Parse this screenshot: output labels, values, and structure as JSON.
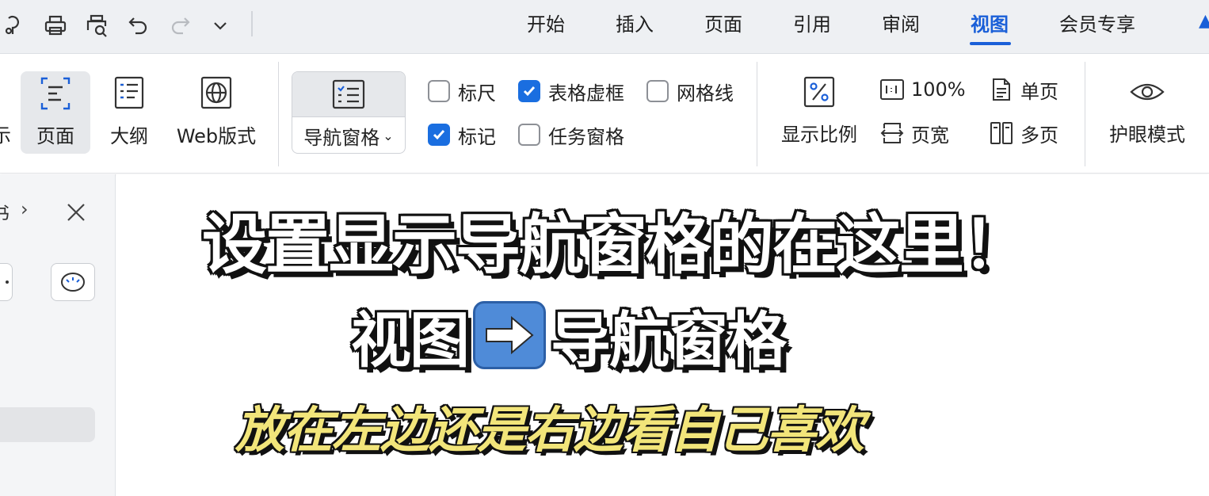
{
  "quick_access": {
    "icons": [
      "brush-icon",
      "print-icon",
      "print-preview-icon",
      "undo-icon",
      "redo-icon",
      "more-dropdown-icon"
    ]
  },
  "menu": {
    "tabs": [
      {
        "label": "开始"
      },
      {
        "label": "插入"
      },
      {
        "label": "页面"
      },
      {
        "label": "引用"
      },
      {
        "label": "审阅"
      },
      {
        "label": "视图",
        "active": true
      },
      {
        "label": "会员专享"
      }
    ],
    "accent_color": "#1a5fd8"
  },
  "ribbon": {
    "cut_label": "示",
    "page_view": {
      "label": "页面",
      "selected": true
    },
    "outline_view": {
      "label": "大纲"
    },
    "web_view": {
      "label": "Web版式"
    },
    "nav_pane": {
      "label": "导航窗格"
    },
    "checkboxes": {
      "ruler": {
        "label": "标尺",
        "checked": false
      },
      "table_grid": {
        "label": "表格虚框",
        "checked": true
      },
      "gridlines": {
        "label": "网格线",
        "checked": false
      },
      "marks": {
        "label": "标记",
        "checked": true
      },
      "task_pane": {
        "label": "任务窗格",
        "checked": false
      }
    },
    "zoom": {
      "label": "显示比例"
    },
    "zoom_100": {
      "label": "100%"
    },
    "page_width": {
      "label": "页宽"
    },
    "single_page": {
      "label": "单页"
    },
    "multi_page": {
      "label": "多页"
    },
    "eye_mode": {
      "label": "护眼模式"
    }
  },
  "side_panel": {
    "title_fragment": "书",
    "arrow": "›"
  },
  "document": {
    "line1": "设置显示导航窗格的在这里！",
    "line2_a": "视图",
    "line2_b": "导航窗格",
    "line3": "放在左边还是右边看自己喜欢"
  }
}
